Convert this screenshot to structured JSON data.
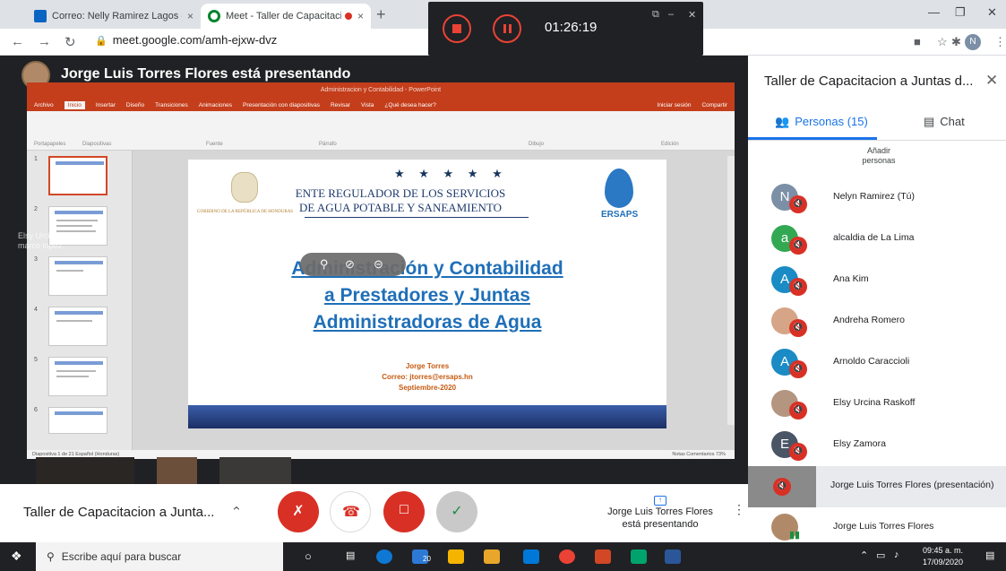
{
  "browser": {
    "tabs": [
      {
        "title": "Correo: Nelly Ramirez Lagos - O",
        "close": "×"
      },
      {
        "title": "Meet - Taller de Capacitacion",
        "close": "×"
      }
    ],
    "new_tab": "+",
    "url": "meet.google.com/amh-ejxw-dvz",
    "profile_initial": "N"
  },
  "recorder": {
    "elapsed": "01:26:19"
  },
  "presenter": {
    "title": "Jorge Luis Torres Flores está presentando"
  },
  "powerpoint": {
    "window_title": "Administracion y Contabilidad - PowerPoint",
    "ribbon_tabs": [
      "Archivo",
      "Inicio",
      "Insertar",
      "Diseño",
      "Transiciones",
      "Animaciones",
      "Presentación con diapositivas",
      "Revisar",
      "Vista",
      "¿Qué desea hacer?"
    ],
    "signin": "Iniciar sesión",
    "share": "Compartir",
    "groups": [
      "Portapapeles",
      "Diapositivas",
      "Fuente",
      "Párrafo",
      "Dibujo",
      "Edición"
    ],
    "thumb_numbers": [
      "1",
      "2",
      "3",
      "4",
      "5",
      "6"
    ],
    "status": "Diapositiva 1 de 21    Español (Honduras)",
    "status_right": "Notas   Comentarios   73%"
  },
  "slide": {
    "stars": "★ ★ ★ ★ ★",
    "ente_line1": "ENTE REGULADOR DE LOS SERVICIOS",
    "ente_line2": "DE AGUA POTABLE Y SANEAMIENTO",
    "gov": "GOBIERNO DE LA REPÚBLICA DE HONDURAS",
    "ersaps": "ERSAPS",
    "heading": [
      "Administración y Contabilidad",
      "a Prestadores y Juntas",
      "Administradoras de Agua"
    ],
    "author": "Jorge Torres",
    "email": "Correo: jtorres@ersaps.hn",
    "date": "Septiembre-2020"
  },
  "overlay_notes": [
    "Elsy Urcina Raskoff",
    "marco lopez"
  ],
  "bottombar": {
    "meeting_name": "Taller de Capacitacion a Junta...",
    "presenting_line1": "Jorge Luis Torres Flores",
    "presenting_line2": "está presentando"
  },
  "panel": {
    "title": "Taller de Capacitacion a Juntas d...",
    "people_tab": "Personas (15)",
    "chat_tab": "Chat",
    "add_people": "Añadir personas",
    "people": [
      {
        "name": "Nelyn Ramirez (Tú)",
        "initial": "N",
        "color": "#7b8fa6",
        "muted": true
      },
      {
        "name": "alcaldia de La Lima",
        "initial": "a",
        "color": "#33a852",
        "muted": true
      },
      {
        "name": "Ana Kim",
        "initial": "A",
        "color": "#1a8bc4",
        "muted": true
      },
      {
        "name": "Andreha Romero",
        "initial": "",
        "color": "#d6a587",
        "muted": true
      },
      {
        "name": "Arnoldo Caraccioli",
        "initial": "A",
        "color": "#1a8bc4",
        "muted": true
      },
      {
        "name": "Elsy Urcina Raskoff",
        "initial": "",
        "color": "#b39580",
        "muted": true
      },
      {
        "name": "Elsy Zamora",
        "initial": "E",
        "color": "#4a5566",
        "muted": true
      },
      {
        "name": "Jorge Luis Torres Flores (presentación)",
        "initial": "",
        "color": "#8a8a8a",
        "muted": true
      },
      {
        "name": "Jorge Luis Torres Flores",
        "initial": "",
        "color": "#b08a68",
        "muted": false
      }
    ]
  },
  "taskbar": {
    "search_placeholder": "Escribe aquí para buscar",
    "time": "09:45 a. m.",
    "date": "17/09/2020",
    "badge": "20"
  },
  "colors": {
    "red": "#d93025",
    "blue": "#1a73e8",
    "green": "#1e8e3e"
  }
}
